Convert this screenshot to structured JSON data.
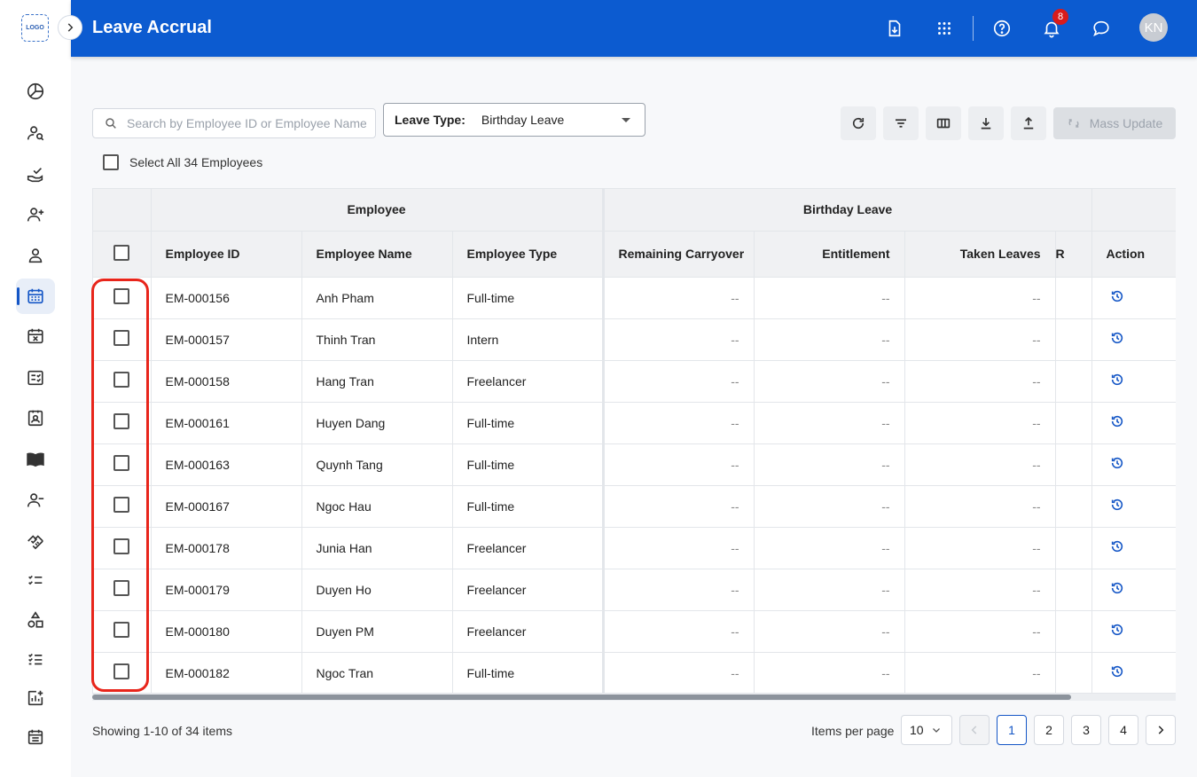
{
  "app": {
    "title": "Leave Accrual",
    "logo_text": "LOGO"
  },
  "header": {
    "notification_count": "8",
    "avatar_initials": "KN"
  },
  "sidebar": {
    "items": [
      {
        "icon": "pie-chart-icon"
      },
      {
        "icon": "user-search-icon"
      },
      {
        "icon": "hand-check-icon"
      },
      {
        "icon": "user-add-icon"
      },
      {
        "icon": "user-icon"
      },
      {
        "icon": "calendar-icon",
        "active": true
      },
      {
        "icon": "calendar-x-icon"
      },
      {
        "icon": "checklist-card-icon"
      },
      {
        "icon": "id-card-icon"
      },
      {
        "icon": "book-icon"
      },
      {
        "icon": "user-remove-icon"
      },
      {
        "icon": "handshake-icon"
      },
      {
        "icon": "task-list-icon"
      },
      {
        "icon": "shapes-icon"
      },
      {
        "icon": "list-check-icon"
      },
      {
        "icon": "chart-add-icon"
      },
      {
        "icon": "schedule-icon"
      }
    ]
  },
  "search": {
    "placeholder": "Search by Employee ID or Employee Name",
    "value": ""
  },
  "leave_type": {
    "label": "Leave Type:",
    "value": "Birthday Leave"
  },
  "toolbar": {
    "mass_update_label": "Mass Update"
  },
  "select_all_label": "Select All 34 Employees",
  "table": {
    "group_headers": {
      "employee": "Employee",
      "leave": "Birthday Leave"
    },
    "columns": {
      "employee_id": "Employee ID",
      "employee_name": "Employee Name",
      "employee_type": "Employee Type",
      "remaining_carryover": "Remaining Carryover",
      "entitlement": "Entitlement",
      "taken_leaves": "Taken Leaves",
      "remaining_cut": "R",
      "action": "Action"
    },
    "rows": [
      {
        "id": "EM-000156",
        "name": "Anh Pham",
        "type": "Full-time",
        "carryover": "--",
        "entitlement": "--",
        "taken": "--"
      },
      {
        "id": "EM-000157",
        "name": "Thinh Tran",
        "type": "Intern",
        "carryover": "--",
        "entitlement": "--",
        "taken": "--"
      },
      {
        "id": "EM-000158",
        "name": "Hang Tran",
        "type": "Freelancer",
        "carryover": "--",
        "entitlement": "--",
        "taken": "--"
      },
      {
        "id": "EM-000161",
        "name": "Huyen Dang",
        "type": "Full-time",
        "carryover": "--",
        "entitlement": "--",
        "taken": "--"
      },
      {
        "id": "EM-000163",
        "name": "Quynh Tang",
        "type": "Full-time",
        "carryover": "--",
        "entitlement": "--",
        "taken": "--"
      },
      {
        "id": "EM-000167",
        "name": "Ngoc Hau",
        "type": "Full-time",
        "carryover": "--",
        "entitlement": "--",
        "taken": "--"
      },
      {
        "id": "EM-000178",
        "name": "Junia Han",
        "type": "Freelancer",
        "carryover": "--",
        "entitlement": "--",
        "taken": "--"
      },
      {
        "id": "EM-000179",
        "name": "Duyen Ho",
        "type": "Freelancer",
        "carryover": "--",
        "entitlement": "--",
        "taken": "--"
      },
      {
        "id": "EM-000180",
        "name": "Duyen PM",
        "type": "Freelancer",
        "carryover": "--",
        "entitlement": "--",
        "taken": "--"
      },
      {
        "id": "EM-000182",
        "name": "Ngoc Tran",
        "type": "Full-time",
        "carryover": "--",
        "entitlement": "--",
        "taken": "--"
      }
    ]
  },
  "footer": {
    "showing": "Showing 1-10 of 34 items",
    "items_per_page_label": "Items per page",
    "items_per_page": "10",
    "pages": [
      "1",
      "2",
      "3",
      "4"
    ],
    "current_page": "1"
  },
  "colors": {
    "header_bg": "#0c5bd0",
    "accent": "#1456c6",
    "highlight": "#e8251b",
    "badge": "#d81b1b"
  }
}
